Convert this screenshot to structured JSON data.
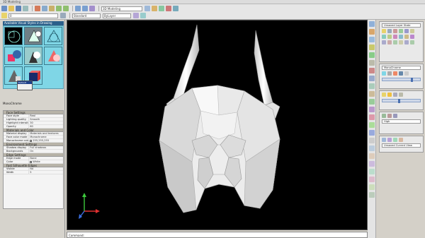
{
  "window": {
    "title": "3D Modeling"
  },
  "toolbar": {
    "workspace_combo": "3D Modeling",
    "layer_combo": "0",
    "style_combo": "Standard",
    "color_combo": "ByLayer"
  },
  "left_palette": {
    "header": "Available Visual Styles in Drawing",
    "visual_style_name": "MonoChrome",
    "popup_label": "Default"
  },
  "properties": {
    "sections": [
      {
        "title": "Face Settings",
        "rows": [
          {
            "label": "Face style",
            "value": "Real"
          },
          {
            "label": "Lighting quality",
            "value": "Smooth"
          },
          {
            "label": "Highlight intensity",
            "value": "30"
          },
          {
            "label": "Opacity",
            "value": "60"
          }
        ]
      },
      {
        "title": "Materials and Color",
        "rows": [
          {
            "label": "Material display",
            "value": "Materials and textures"
          },
          {
            "label": "Face color mode",
            "value": "Monochrome"
          },
          {
            "label": "Monochrome color",
            "value": "255,255,255"
          }
        ]
      },
      {
        "title": "Environment Settings",
        "rows": [
          {
            "label": "Shadow display",
            "value": "Full shadows"
          },
          {
            "label": "Backgrounds",
            "value": "On"
          }
        ]
      },
      {
        "title": "Edge Settings",
        "rows": [
          {
            "label": "Edge mode",
            "value": "None"
          },
          {
            "label": "Color",
            "value": "White"
          }
        ]
      },
      {
        "title": "Fast Silhouette Edges",
        "rows": [
          {
            "label": "Visible",
            "value": "No"
          },
          {
            "label": "Width",
            "value": "5"
          }
        ]
      }
    ]
  },
  "right_panel": {
    "layer_state": "Unsaved Layer State",
    "visual_style": "MonoChrome",
    "quality": "High",
    "view": "Unsaved Current View"
  },
  "command": {
    "tab_label": "Command:"
  },
  "colors": {
    "viewport_bg": "#000000",
    "vm_bg": "#7fd6e6",
    "accent": "#2b5f8a"
  }
}
